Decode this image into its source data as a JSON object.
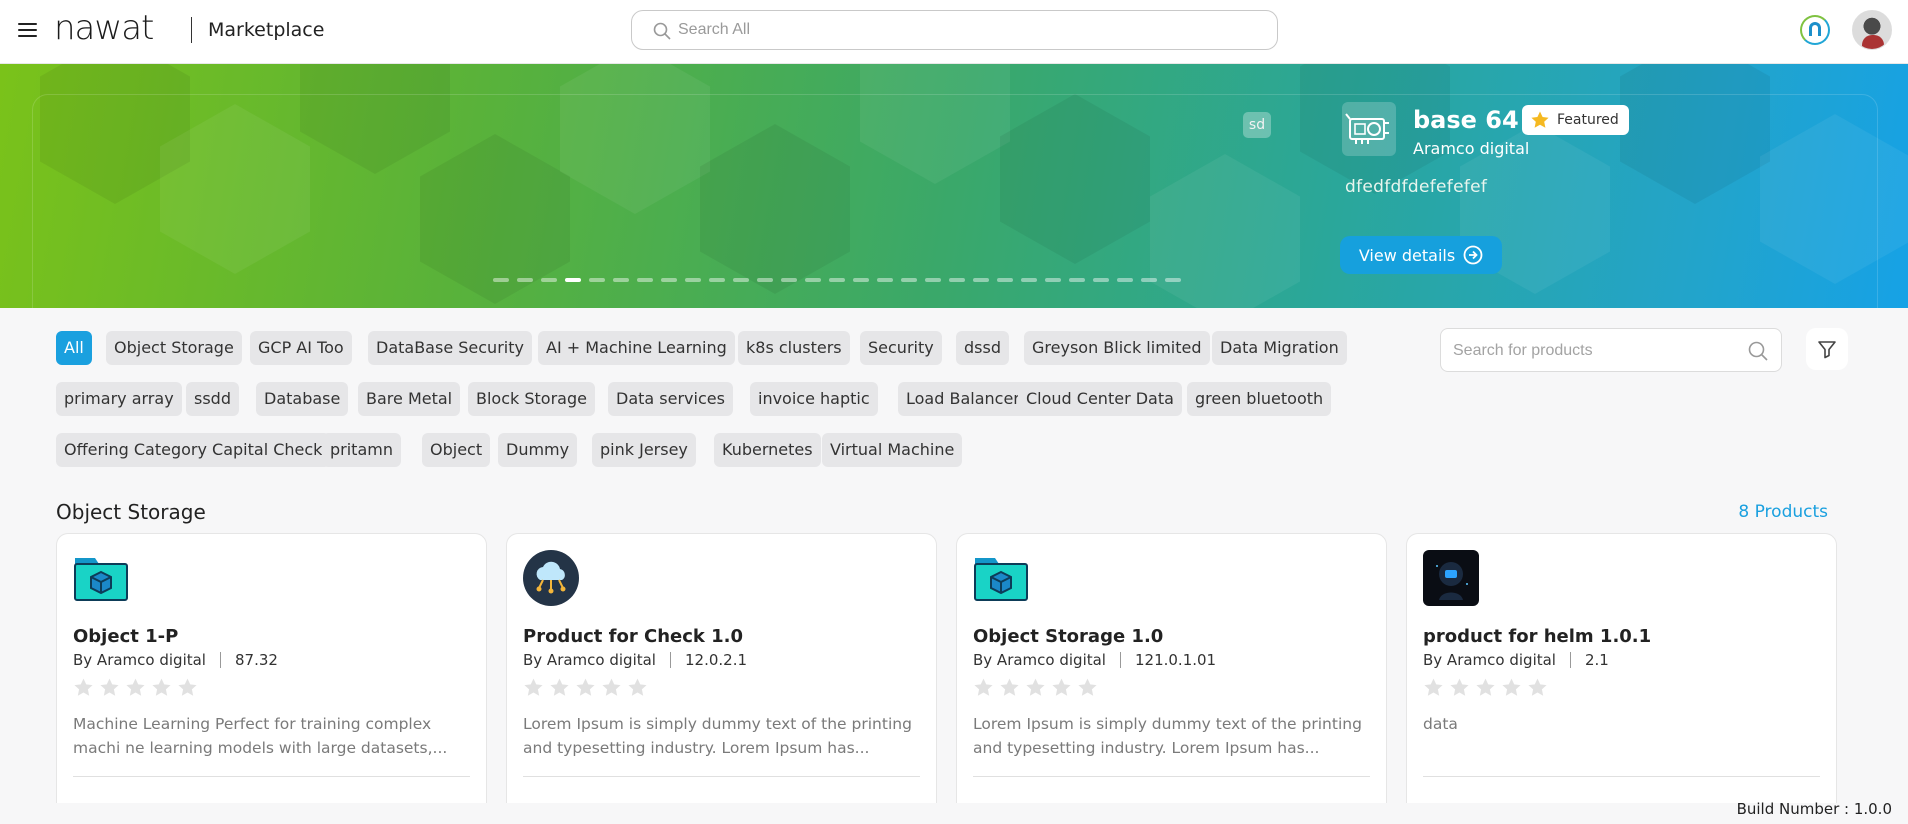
{
  "header": {
    "logo_text": "nawat",
    "app_title": "Marketplace",
    "search_placeholder": "Search All"
  },
  "hero": {
    "tag": "sd",
    "product_name": "base 64",
    "featured_label": "Featured",
    "vendor": "Aramco digital",
    "description": "dfedfdfdefefefef",
    "view_button": "View details",
    "dot_count": 29,
    "active_dot": 4
  },
  "chips": [
    {
      "label": "All",
      "active": true
    },
    {
      "label": "Object Storage"
    },
    {
      "label": "GCP AI Too"
    },
    {
      "label": "DataBase Security"
    },
    {
      "label": "AI + Machine Learning"
    },
    {
      "label": "k8s clusters"
    },
    {
      "label": "Security"
    },
    {
      "label": "dssd"
    },
    {
      "label": "Greyson Blick limited"
    },
    {
      "label": "Data Migration"
    },
    {
      "label": "primary array"
    },
    {
      "label": "ssdd"
    },
    {
      "label": "Database"
    },
    {
      "label": "Bare Metal"
    },
    {
      "label": "Block Storage"
    },
    {
      "label": "Data services"
    },
    {
      "label": "invoice haptic"
    },
    {
      "label": "Load Balancer"
    },
    {
      "label": "Cloud Center Data"
    },
    {
      "label": "green bluetooth"
    },
    {
      "label": "Offering Category Capital Check"
    },
    {
      "label": "pritamn"
    },
    {
      "label": "Object"
    },
    {
      "label": "Dummy"
    },
    {
      "label": "pink Jersey"
    },
    {
      "label": "Kubernetes"
    },
    {
      "label": "Virtual Machine"
    }
  ],
  "product_search_placeholder": "Search for products",
  "section": {
    "title": "Object Storage",
    "count": "8 Products"
  },
  "cards": [
    {
      "icon": "folder-box-icon",
      "name": "Object 1-P",
      "vendor": "By Aramco digital",
      "version": "87.32",
      "rating": 0,
      "description": "Machine Learning Perfect for training complex machi ne learning models with large datasets,..."
    },
    {
      "icon": "cloud-network-icon",
      "name": "Product for Check 1.0",
      "vendor": "By Aramco digital",
      "version": "12.0.2.1",
      "rating": 0,
      "description": "Lorem Ipsum is simply dummy text of the printing and typesetting industry. Lorem Ipsum has..."
    },
    {
      "icon": "folder-box-icon",
      "name": "Object Storage 1.0",
      "vendor": "By Aramco digital",
      "version": "121.0.1.01",
      "rating": 0,
      "description": "Lorem Ipsum is simply dummy text of the printing and typesetting industry. Lorem Ipsum has..."
    },
    {
      "icon": "ai-robot-icon",
      "name": "product for helm 1.0.1",
      "vendor": "By Aramco digital",
      "version": "2.1",
      "rating": 0,
      "description": "data"
    }
  ],
  "build_number": "Build Number : 1.0.0",
  "colors": {
    "accent": "#1aa0df",
    "hero_start": "#7ac21a",
    "hero_end": "#16a2e6"
  }
}
